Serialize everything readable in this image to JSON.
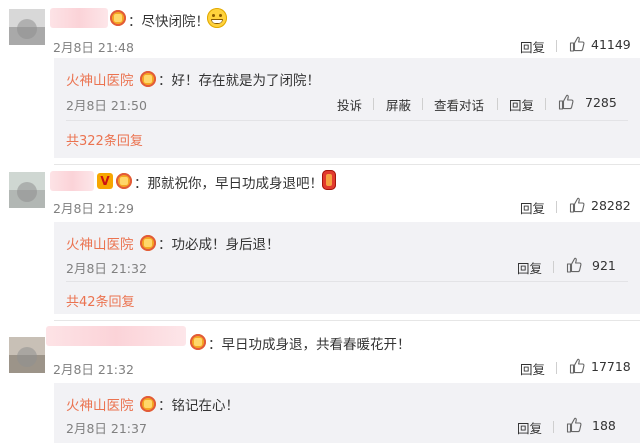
{
  "comments": [
    {
      "text": "：尽快闭院！",
      "time": "2月8日 21:48",
      "reply_label": "回复",
      "likes": "41149",
      "reply": {
        "author": "火神山医院",
        "text": "：好！存在就是为了闭院！",
        "time": "2月8日 21:50",
        "actions": [
          "投诉",
          "屏蔽",
          "查看对话",
          "回复"
        ],
        "likes": "7285"
      },
      "more": "共322条回复"
    },
    {
      "text": "：那就祝你，早日功成身退吧！",
      "time": "2月8日 21:29",
      "reply_label": "回复",
      "likes": "28282",
      "reply": {
        "author": "火神山医院",
        "text": "：功必成！身后退！",
        "time": "2月8日 21:32",
        "reply_label": "回复",
        "likes": "921"
      },
      "more": "共42条回复"
    },
    {
      "text": "：早日功成身退，共看春暖花开！",
      "time": "2月8日 21:32",
      "reply_label": "回复",
      "likes": "17718",
      "reply": {
        "author": "火神山医院",
        "text": "：铭记在心！",
        "time": "2月8日 21:37",
        "reply_label": "回复",
        "likes": "188"
      }
    }
  ],
  "icons": {
    "like": "thumbs-up-icon",
    "badge": "fan-badge-icon",
    "verified": "verified-v-icon",
    "emoji1": "grin-emoji-icon",
    "emoji2": "lantern-emoji-icon"
  },
  "colors": {
    "accent": "#eb7350",
    "text": "#333333",
    "muted": "#808080",
    "reply_bg": "#f2f2f5"
  }
}
